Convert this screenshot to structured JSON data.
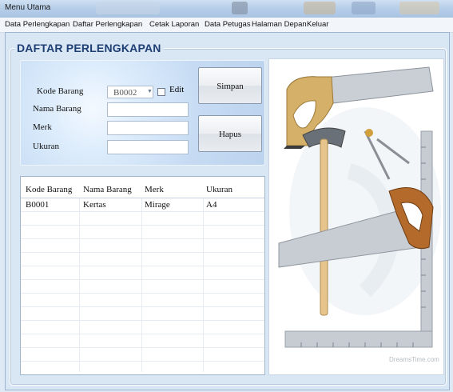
{
  "window": {
    "title": "Menu Utama"
  },
  "menu": {
    "items": [
      "Data Perlengkapan",
      "Daftar Perlengkapan",
      "Cetak Laporan",
      "Data Petugas",
      "Halaman Depan",
      "Keluar"
    ]
  },
  "section": {
    "title": "DAFTAR PERLENGKAPAN"
  },
  "form": {
    "kode_label": "Kode Barang",
    "nama_label": "Nama Barang",
    "merk_label": "Merk",
    "ukuran_label": "Ukuran",
    "kode_value": "B0002",
    "nama_value": "",
    "merk_value": "",
    "ukuran_value": "",
    "edit_label": "Edit",
    "edit_checked": false
  },
  "buttons": {
    "simpan": "Simpan",
    "hapus": "Hapus"
  },
  "table": {
    "headers": [
      "Kode Barang",
      "Nama Barang",
      "Merk",
      "Ukuran"
    ],
    "rows": [
      [
        "B0001",
        "Kertas",
        "Mirage",
        "A4"
      ]
    ]
  },
  "image": {
    "subject": "tools-illustration",
    "watermark": "DreamsTime.com"
  },
  "colors": {
    "title": "#1e3f73",
    "panel_bg": "#d9e6f4",
    "form_glow": "#dcecfc"
  }
}
